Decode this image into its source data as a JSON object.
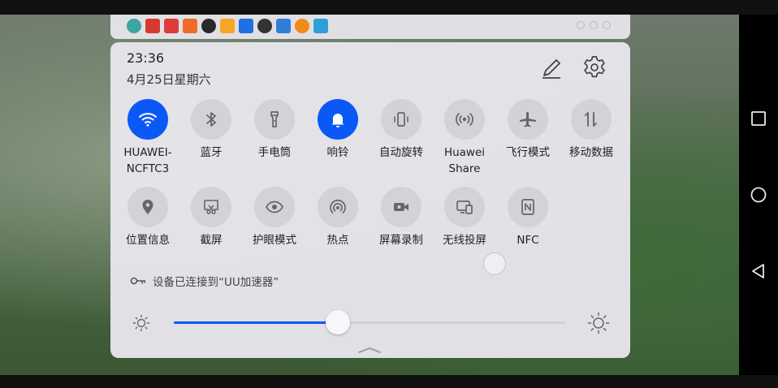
{
  "panel": {
    "time": "23:36",
    "date": "4月25日星期六"
  },
  "tiles_row1": [
    {
      "label": "HUAWEI-\nNCFTC3",
      "icon": "wifi-icon",
      "active": true
    },
    {
      "label": "蓝牙",
      "icon": "bluetooth-icon",
      "active": false
    },
    {
      "label": "手电筒",
      "icon": "flashlight-icon",
      "active": false
    },
    {
      "label": "响铃",
      "icon": "bell-icon",
      "active": true
    },
    {
      "label": "自动旋转",
      "icon": "auto-rotate-icon",
      "active": false
    },
    {
      "label": "Huawei\nShare",
      "icon": "huawei-share-icon",
      "active": false
    },
    {
      "label": "飞行模式",
      "icon": "airplane-icon",
      "active": false
    },
    {
      "label": "移动数据",
      "icon": "mobile-data-icon",
      "active": false
    }
  ],
  "tiles_row2": [
    {
      "label": "位置信息",
      "icon": "location-icon",
      "active": false
    },
    {
      "label": "截屏",
      "icon": "screenshot-icon",
      "active": false
    },
    {
      "label": "护眼模式",
      "icon": "eye-comfort-icon",
      "active": false
    },
    {
      "label": "热点",
      "icon": "hotspot-icon",
      "active": false
    },
    {
      "label": "屏幕录制",
      "icon": "screen-record-icon",
      "active": false
    },
    {
      "label": "无线投屏",
      "icon": "wireless-projection-icon",
      "active": false
    },
    {
      "label": "NFC",
      "icon": "nfc-icon",
      "active": false
    }
  ],
  "vpn": {
    "text": "设备已连接到“UU加速器”"
  },
  "brightness": {
    "level": 0.42
  },
  "colors": {
    "accent": "#0a59f7",
    "tile_inactive": "#d3d2d8",
    "panel_bg": "#e8e6ec"
  }
}
